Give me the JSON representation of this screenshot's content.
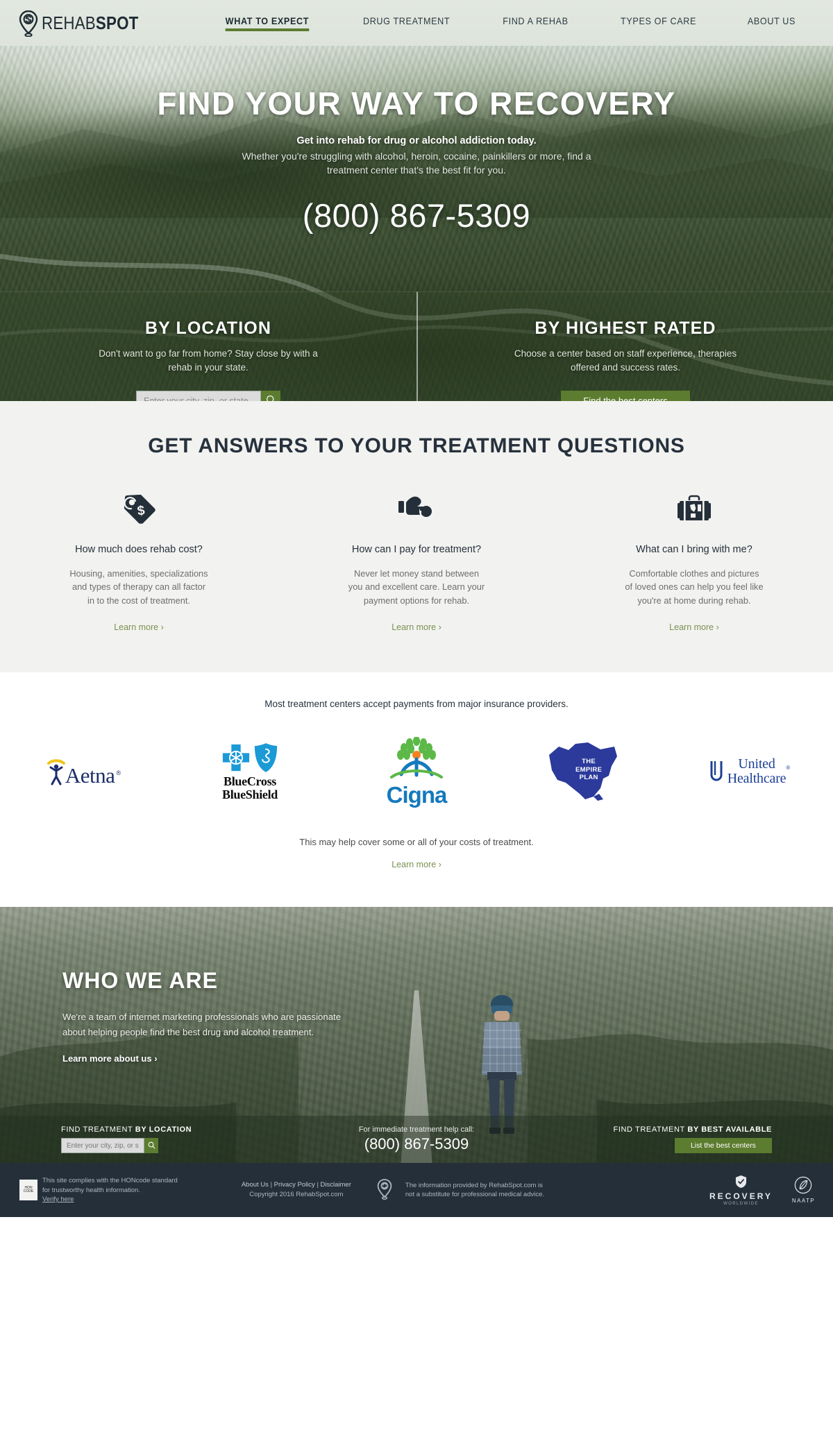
{
  "brand": {
    "name_light": "REHAB",
    "name_bold": "SPOT",
    "pin_icon": "map-pin-recovery-icon"
  },
  "nav": {
    "items": [
      {
        "label": "WHAT TO EXPECT",
        "active": true
      },
      {
        "label": "DRUG TREATMENT",
        "active": false
      },
      {
        "label": "FIND A REHAB",
        "active": false
      },
      {
        "label": "TYPES OF CARE",
        "active": false
      },
      {
        "label": "ABOUT US",
        "active": false
      }
    ]
  },
  "hero": {
    "title": "FIND YOUR WAY TO RECOVERY",
    "subtitle_bold": "Get into rehab for drug or alcohol addiction today.",
    "subtitle_line1": "Whether you're struggling with alcohol, heroin, cocaine, painkillers or more, find a",
    "subtitle_line2": "treatment center that's the best fit for you.",
    "phone": "(800) 867-5309",
    "panels": [
      {
        "title": "BY LOCATION",
        "desc_line1": "Don't want to go far from home? Stay close by with a",
        "desc_line2": "rehab in your state.",
        "search_placeholder": "Enter your city, zip, or state",
        "search_value": ""
      },
      {
        "title": "BY HIGHEST RATED",
        "desc_line1": "Choose a center based on staff experience, therapies",
        "desc_line2": "offered and success rates.",
        "button_label": "Find the best centers"
      }
    ]
  },
  "questions": {
    "title": "GET ANSWERS TO YOUR TREATMENT QUESTIONS",
    "cards": [
      {
        "icon": "price-tag-dollar-icon",
        "title": "How much does rehab cost?",
        "desc_line1": "Housing, amenities, specializations",
        "desc_line2": "and types of therapy can all factor",
        "desc_line3": "in to the cost of treatment.",
        "link": "Learn more ›"
      },
      {
        "icon": "hand-holding-coin-icon",
        "title": "How can I pay for treatment?",
        "desc_line1": "Never let money stand between",
        "desc_line2": "you and excellent care. Learn your",
        "desc_line3": "payment options for rehab.",
        "link": "Learn more ›"
      },
      {
        "icon": "suitcase-icon",
        "title": "What can I bring with me?",
        "desc_line1": "Comfortable clothes and pictures",
        "desc_line2": "of loved ones can help you feel like",
        "desc_line3": "you're at home during rehab.",
        "link": "Learn more ›"
      }
    ]
  },
  "insurance": {
    "lead": "Most treatment centers accept payments from major insurance providers.",
    "logos": [
      {
        "name": "Aetna",
        "icon": "aetna-logo"
      },
      {
        "name": "BlueCross BlueShield",
        "line1": "BlueCross",
        "line2": "BlueShield",
        "icon": "bluecross-blueshield-logo"
      },
      {
        "name": "Cigna",
        "icon": "cigna-logo"
      },
      {
        "name": "The Empire Plan",
        "line1": "THE",
        "line2": "EMPIRE",
        "line3": "PLAN",
        "icon": "empire-plan-logo"
      },
      {
        "name": "United Healthcare",
        "line1": "United",
        "line2": "Healthcare",
        "icon": "united-healthcare-logo"
      }
    ],
    "footnote": "This may help cover some or all of your costs of treatment.",
    "link": "Learn more ›"
  },
  "who": {
    "title": "WHO WE ARE",
    "desc_line1": "We're a team of internet marketing professionals who are passionate",
    "desc_line2": "about helping people find the best drug and alcohol treatment.",
    "link": "Learn more about us ›"
  },
  "cta": {
    "left_label_light": "FIND TREATMENT ",
    "left_label_bold": "BY LOCATION",
    "left_placeholder": "Enter your city, zip, or state",
    "left_value": "",
    "center_label": "For immediate treatment help call:",
    "center_phone": "(800) 867-5309",
    "right_label_light": "FIND TREATMENT ",
    "right_label_bold": "BY BEST AVAILABLE",
    "right_button": "List the best centers"
  },
  "footer": {
    "hon_badge_line1": "HON",
    "hon_badge_line2": "CODE",
    "hon_line1": "This site complies with the HONcode standard",
    "hon_line2": "for trustworthy health information.",
    "hon_verify": "Verify here",
    "links": [
      "About Us",
      "Privacy Policy",
      "Disclaimer"
    ],
    "link_sep": "|",
    "copyright": "Copyright 2016 RehabSpot.com",
    "pin_icon": "map-pin-icon",
    "disclaimer_line1": "The information provided by RehabSpot.com is",
    "disclaimer_line2": "not a substitute for professional medical advice.",
    "recovery_word": "RECOVERY",
    "recovery_sub": "WORLDWIDE",
    "naatp_word": "NAATP",
    "naatp_icon": "naatp-leaf-icon"
  },
  "colors": {
    "accent_green": "#5c7c2f",
    "link_green": "#7a9150",
    "dark_navy": "#252f3a",
    "heading": "#26313c",
    "light_bg": "#f2f2f0"
  }
}
